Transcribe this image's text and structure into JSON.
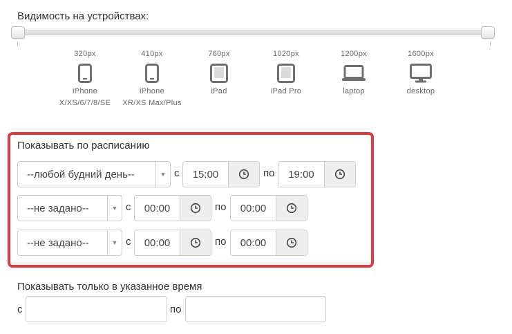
{
  "visibility": {
    "label": "Видимость на устройствах:",
    "devices": [
      {
        "px": "320px",
        "icon": "phone-icon",
        "name": "iPhone",
        "sub": "X/XS/6/7/8/SE"
      },
      {
        "px": "410px",
        "icon": "phone-icon",
        "name": "iPhone",
        "sub": "XR/XS Max/Plus"
      },
      {
        "px": "760px",
        "icon": "tablet-icon",
        "name": "iPad",
        "sub": ""
      },
      {
        "px": "1020px",
        "icon": "tablet-icon",
        "name": "iPad Pro",
        "sub": ""
      },
      {
        "px": "1200px",
        "icon": "laptop-icon",
        "name": "laptop",
        "sub": ""
      },
      {
        "px": "1600px",
        "icon": "desktop-icon",
        "name": "desktop",
        "sub": ""
      }
    ]
  },
  "schedule": {
    "title": "Показывать по расписанию",
    "border_color": "#e0393e",
    "rows": [
      {
        "day": "--любой будний день--",
        "from_label": "с",
        "from": "15:00",
        "to_label": "по",
        "to": "19:00"
      },
      {
        "day": "--не задано--",
        "from_label": "с",
        "from": "00:00",
        "to_label": "по",
        "to": "00:00"
      },
      {
        "day": "--не задано--",
        "from_label": "с",
        "from": "00:00",
        "to_label": "по",
        "to": "00:00"
      }
    ]
  },
  "time_range": {
    "title": "Показывать только в указанное время",
    "from_label": "с",
    "from_value": "",
    "to_label": "по",
    "to_value": ""
  }
}
